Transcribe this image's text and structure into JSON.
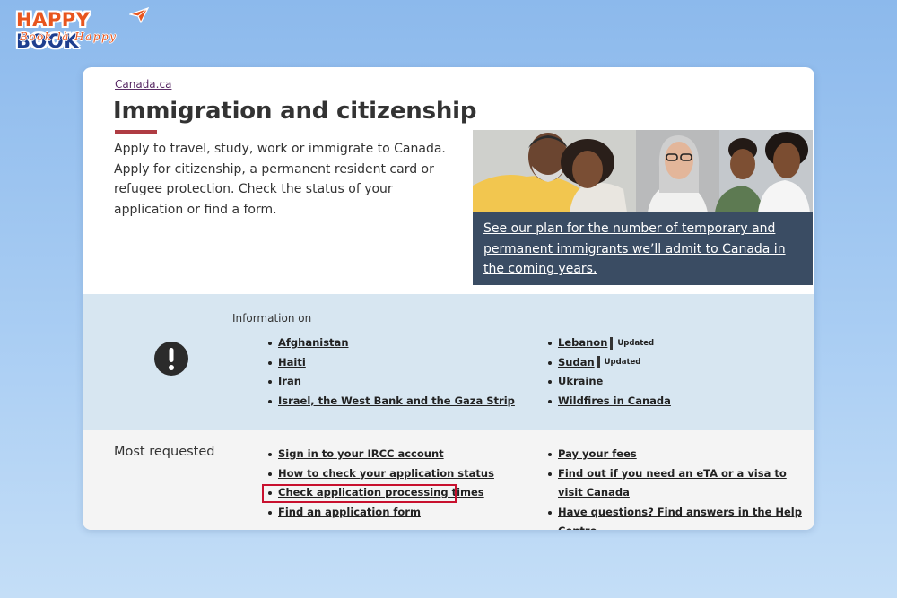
{
  "watermark": {
    "line1_a": "HAPPY",
    "line1_b": "BOOK",
    "line2": "Book là Happy"
  },
  "breadcrumb": "Canada.ca",
  "page": {
    "title": "Immigration and citizenship",
    "intro": "Apply to travel, study, work or immigrate to Canada. Apply for citizenship, a permanent resident card or refugee protection. Check the status of your application or find a form."
  },
  "feature": {
    "link_text": "See our plan for the number of temporary and permanent immigrants we’ll admit to Canada in the coming years."
  },
  "info": {
    "label": "Information on",
    "badge": "Updated",
    "left": [
      {
        "label": "Afghanistan"
      },
      {
        "label": "Haiti"
      },
      {
        "label": "Iran"
      },
      {
        "label": "Israel, the West Bank and the Gaza Strip"
      }
    ],
    "right": [
      {
        "label": "Lebanon",
        "badge": "Updated"
      },
      {
        "label": "Sudan",
        "badge": "Updated"
      },
      {
        "label": "Ukraine"
      },
      {
        "label": "Wildfires in Canada"
      }
    ]
  },
  "most_requested": {
    "title": "Most requested",
    "left": [
      {
        "label": "Sign in to your IRCC account"
      },
      {
        "label": "How to check your application status"
      },
      {
        "label": "Check application processing times"
      },
      {
        "label": "Find an application form"
      }
    ],
    "right": [
      {
        "label": "Pay your fees"
      },
      {
        "label": "Find out if you need an eTA or a visa to visit Canada"
      },
      {
        "label": "Have questions? Find answers in the Help Centre"
      }
    ]
  },
  "colors": {
    "accent_bar": "#af3c43",
    "feature_bg": "#3a4c63",
    "info_band": "#d7e6f1",
    "highlight_box": "#c8102e"
  },
  "icons": {
    "alert": "exclamation-circle-icon"
  }
}
